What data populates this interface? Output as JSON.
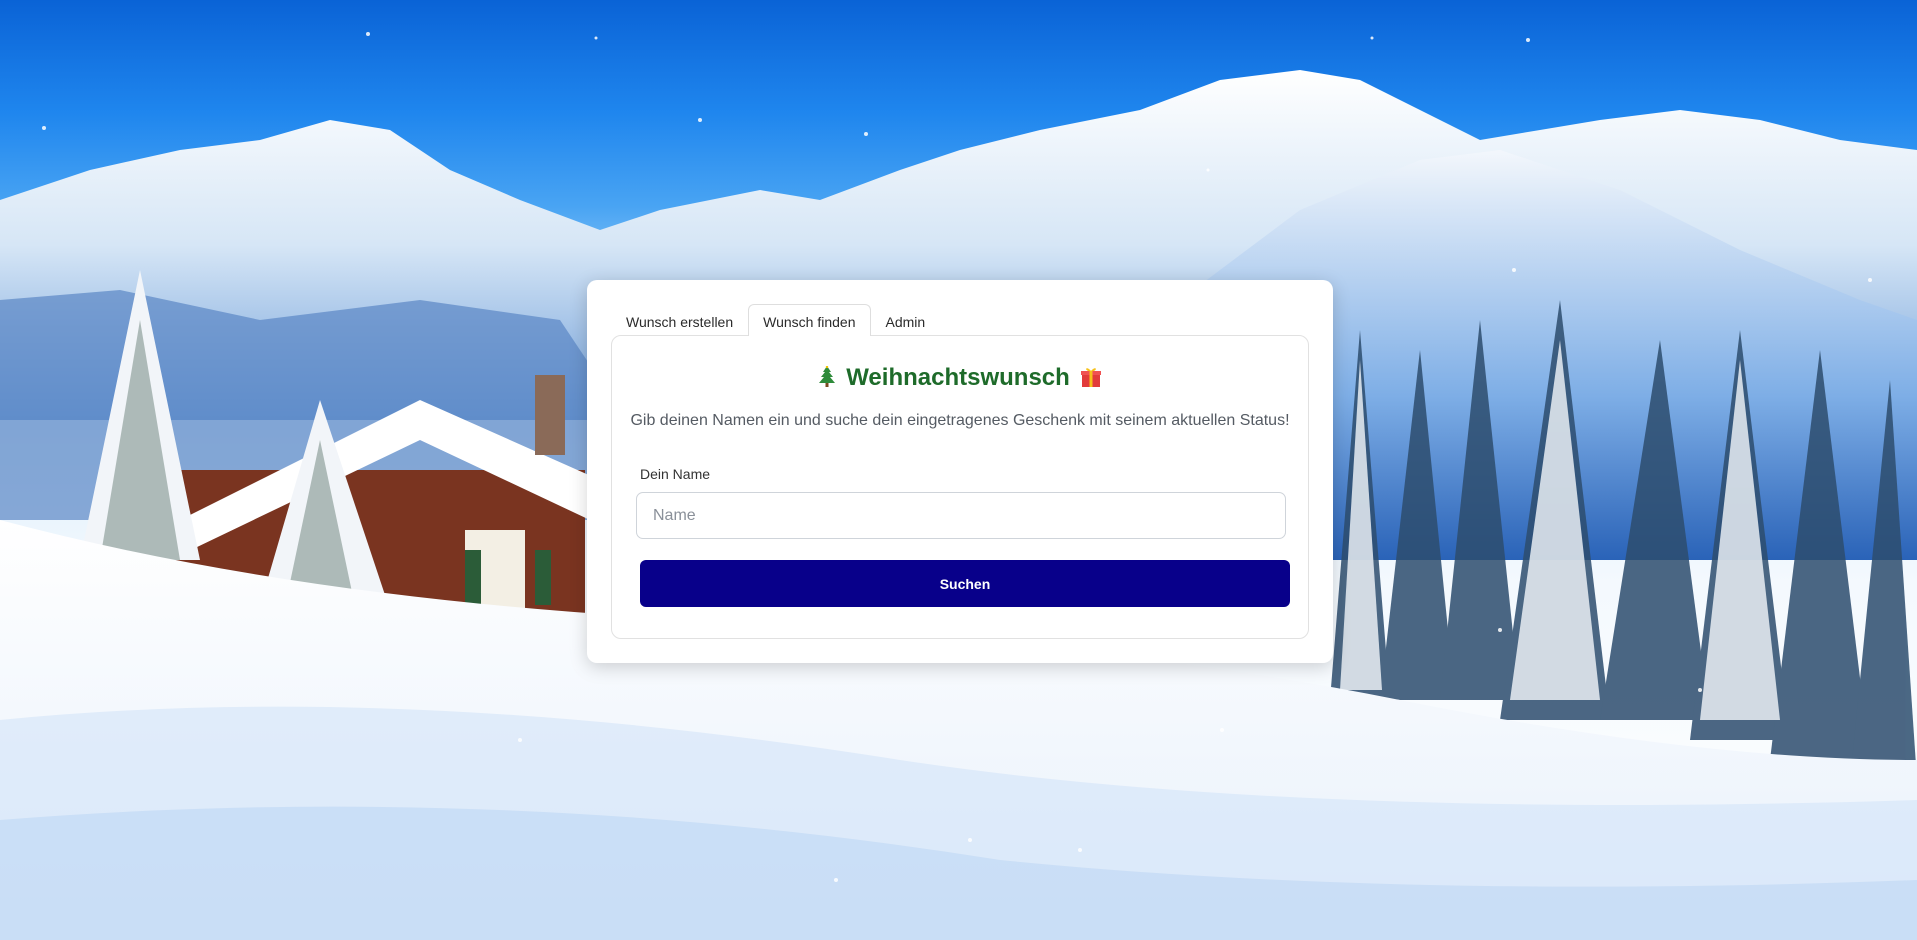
{
  "tabs": [
    {
      "label": "Wunsch erstellen",
      "active": false
    },
    {
      "label": "Wunsch finden",
      "active": true
    },
    {
      "label": "Admin",
      "active": false
    }
  ],
  "panel": {
    "title": "Weihnachtswunsch",
    "title_icons": [
      "christmas-tree-icon",
      "gift-icon"
    ],
    "subtitle": "Gib deinen Namen ein und suche dein eingetragenes Geschenk mit seinem aktuellen Status!",
    "name_label": "Dein Name",
    "name_placeholder": "Name",
    "name_value": "",
    "search_button": "Suchen"
  },
  "colors": {
    "title": "#1e6b2a",
    "button": "#08008a",
    "sky": "#1f86ee"
  }
}
